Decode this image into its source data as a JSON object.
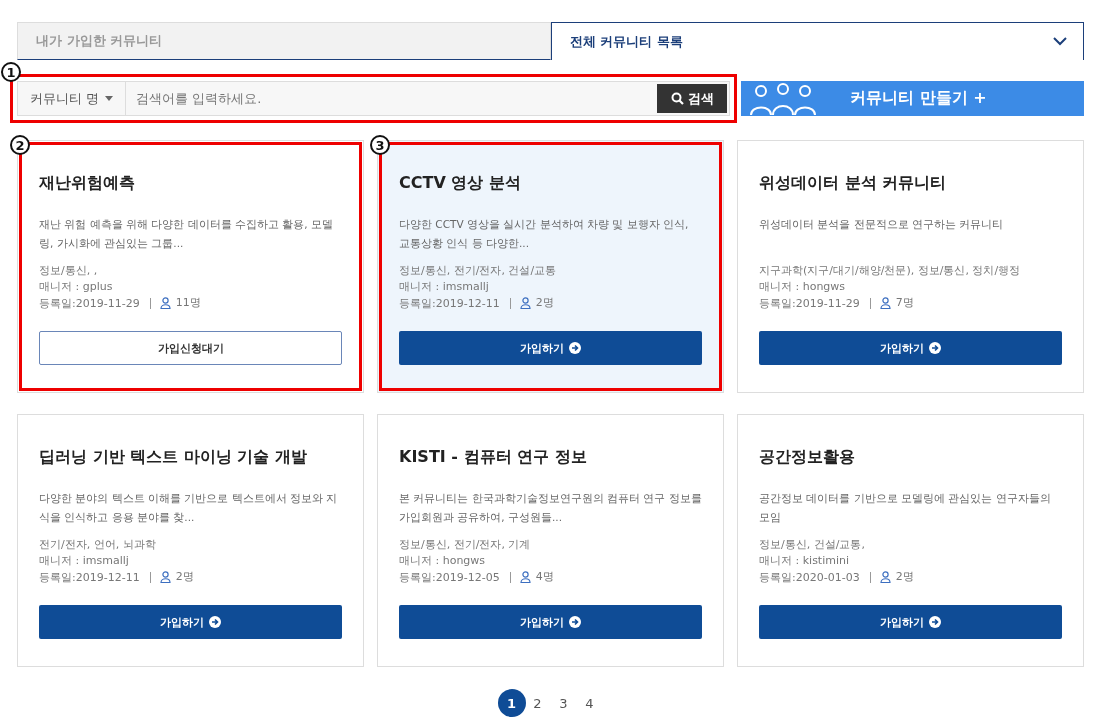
{
  "tabs": [
    {
      "label": "내가 가입한 커뮤니티",
      "selected": false
    },
    {
      "label": "전체 커뮤니티 목록",
      "selected": true
    }
  ],
  "search": {
    "callout": "1",
    "filter": "커뮤니티 명",
    "placeholder": "검색어를 입력하세요.",
    "button": "검색"
  },
  "create_button": "커뮤니티 만들기 +",
  "cards": [
    {
      "title": "재난위험예측",
      "description": "재난 위험 예측을 위해 다양한 데이터를 수집하고 활용, 모델링, 가시화에 관심있는 그룹...",
      "fields": "정보/통신, ,",
      "manager": "매니저 : gplus",
      "registered": "등록일:2019-11-29",
      "members": "11명",
      "button": {
        "kind": "pending",
        "label": "가입신청대기"
      },
      "highlighted": false,
      "callout": "2"
    },
    {
      "title": "CCTV 영상 분석",
      "description": "다양한 CCTV 영상을 실시간 분석하여 차량 및 보행자 인식, 교통상황 인식 등 다양한...",
      "fields": "정보/통신, 전기/전자, 건설/교통",
      "manager": "매니저 : imsmallj",
      "registered": "등록일:2019-12-11",
      "members": "2명",
      "button": {
        "kind": "join",
        "label": "가입하기"
      },
      "highlighted": true,
      "callout": "3"
    },
    {
      "title": "위성데이터 분석 커뮤니티",
      "description": "위성데이터 분석을 전문적으로 연구하는 커뮤니티",
      "fields": "지구과학(지구/대기/해양/천문), 정보/통신, 정치/행정",
      "manager": "매니저 : hongws",
      "registered": "등록일:2019-11-29",
      "members": "7명",
      "button": {
        "kind": "join",
        "label": "가입하기"
      },
      "highlighted": false
    },
    {
      "title": "딥러닝 기반 텍스트 마이닝 기술 개발",
      "description": "다양한 분야의 텍스트 이해를 기반으로 텍스트에서 정보와 지식을 인식하고 응용 분야를 찾...",
      "fields": "전기/전자, 언어, 뇌과학",
      "manager": "매니저 : imsmallj",
      "registered": "등록일:2019-12-11",
      "members": "2명",
      "button": {
        "kind": "join",
        "label": "가입하기"
      },
      "highlighted": false
    },
    {
      "title": "KISTI - 컴퓨터 연구 정보",
      "description": "본 커뮤니티는 한국과학기술정보연구원의 컴퓨터 연구 정보를 가입회원과 공유하여, 구성원들...",
      "fields": "정보/통신, 전기/전자, 기계",
      "manager": "매니저 : hongws",
      "registered": "등록일:2019-12-05",
      "members": "4명",
      "button": {
        "kind": "join",
        "label": "가입하기"
      },
      "highlighted": false
    },
    {
      "title": "공간정보활용",
      "description": "공간정보 데이터를 기반으로 모델링에 관심있는 연구자들의 모임",
      "fields": "정보/통신, 건설/교통,",
      "manager": "매니저 : kistimini",
      "registered": "등록일:2020-01-03",
      "members": "2명",
      "button": {
        "kind": "join",
        "label": "가입하기"
      },
      "highlighted": false
    }
  ],
  "pagination": [
    {
      "label": "1",
      "selected": true
    },
    {
      "label": "2",
      "selected": false
    },
    {
      "label": "3",
      "selected": false
    },
    {
      "label": "4",
      "selected": false
    }
  ]
}
